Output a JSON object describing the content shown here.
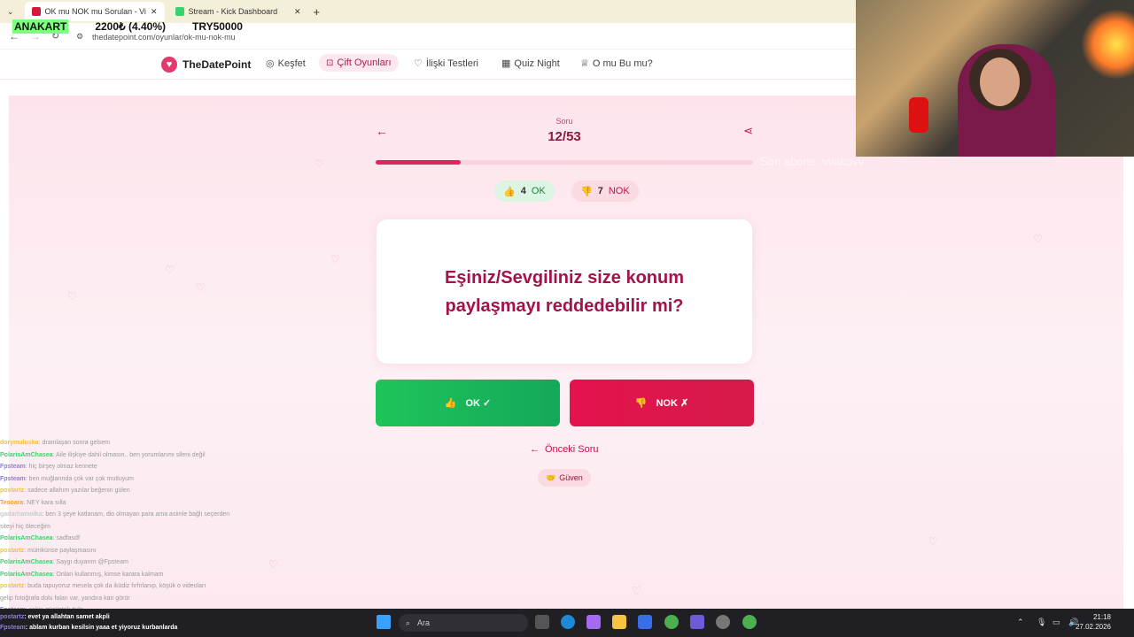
{
  "browser": {
    "tabs": [
      {
        "title": "OK mu NOK mu Sorulan - Viral",
        "color": "#d11a3a",
        "active": true
      },
      {
        "title": "Stream - Kick Dashboard",
        "color": "#3bd16f",
        "active": false
      }
    ],
    "new_tab": "+",
    "url": "thedatepoint.com/oyunlar/ok-mu-nok-mu"
  },
  "ticker": {
    "label": "ANAKART",
    "price": "2200₺ (4.40%)",
    "goal": "TRY50000"
  },
  "site": {
    "brand": "TheDatePoint",
    "nav": [
      {
        "label": "Keşfet",
        "icon": "compass-icon",
        "glyph": "◎"
      },
      {
        "label": "Çift Oyunları",
        "icon": "gamepad-icon",
        "glyph": "🎮"
      },
      {
        "label": "İlişki Testleri",
        "icon": "heart-icon",
        "glyph": "♡"
      },
      {
        "label": "Quiz Night",
        "icon": "calendar-icon",
        "glyph": "▦"
      },
      {
        "label": "O mu Bu mu?",
        "icon": "trophy-icon",
        "glyph": "♕"
      }
    ]
  },
  "quiz": {
    "label": "Soru",
    "counter": "12/53",
    "progress": 0.226,
    "ok_count": "4",
    "ok_label": "OK",
    "nok_count": "7",
    "nok_label": "NOK",
    "question": "Eşiniz/Sevgiliniz size konum paylaşmayı reddedebilir mi?",
    "ok_button": "OK ✓",
    "nok_button": "NOK ✗",
    "prev": "Önceki Soru",
    "tag": "Güven"
  },
  "overlay": {
    "text": "Son abone: vvakovv"
  },
  "chat": [
    {
      "user": "dorymuluska",
      "color": "#f0c040",
      "msg": ": dramlaşan sonra gelsem"
    },
    {
      "user": "PolarisAmChasea",
      "color": "#3bd16f",
      "msg": ": Aile ilişkiye dahil olmasın.. ben yorumlarımı sileni değil"
    },
    {
      "user": "Fpsteam",
      "color": "#8a7cf0",
      "msg": ": hiç birşey olmaz kennete"
    },
    {
      "user": "Fpsteam",
      "color": "#8a7cf0",
      "msg": ": ben muğlarında çok var çok mutluyum"
    },
    {
      "user": "postartz",
      "color": "#f0c040",
      "msg": ": sadece allahım yazılar beğenin gülen"
    },
    {
      "user": "Tesoara",
      "color": "#f0a030",
      "msg": ": NEY kara sılla"
    },
    {
      "user": "gadarhamolka",
      "color": "#ccc",
      "msg": ": ben 3 şeye katlanam, dio olmayan para ama asimle bağlı seçerden"
    },
    {
      "user": "",
      "color": "#ccc",
      "msg": "siteyi hiç öleceğim"
    },
    {
      "user": "PolarisAmChasea",
      "color": "#3bd16f",
      "msg": ": sadfasdf"
    },
    {
      "user": "postartz",
      "color": "#f0c040",
      "msg": ": mümkünse paylaşmasını"
    },
    {
      "user": "PolarisAmChasea",
      "color": "#3bd16f",
      "msg": ": Saygı duyarım @Fpsteam"
    },
    {
      "user": "PolarisAmChasea",
      "color": "#3bd16f",
      "msg": ": Onları kullanmış, kimse karara kalmam"
    },
    {
      "user": "postartz",
      "color": "#f0c040",
      "msg": ": buda tapuyoruz mesela çok da iküdiz fırfırlanıp, köşük o videoları"
    },
    {
      "user": "",
      "color": "#ccc",
      "msg": "gelip fotoğrafa dolu falan var, yandıra kan görür"
    },
    {
      "user": "Fpsteam",
      "color": "#8a7cf0",
      "msg": ": sakin güzüştek öyle"
    }
  ],
  "taskbar_chat": [
    {
      "user": "postartz",
      "msg": ": evet ya allahtan samet akpli"
    },
    {
      "user": "Fpsteam",
      "msg": ": ablam kurban kesilsin yaaa et yiyoruz kurbanlarda"
    }
  ],
  "taskbar": {
    "search": "Ara",
    "time": "21:18",
    "date": "27.02.2026"
  }
}
